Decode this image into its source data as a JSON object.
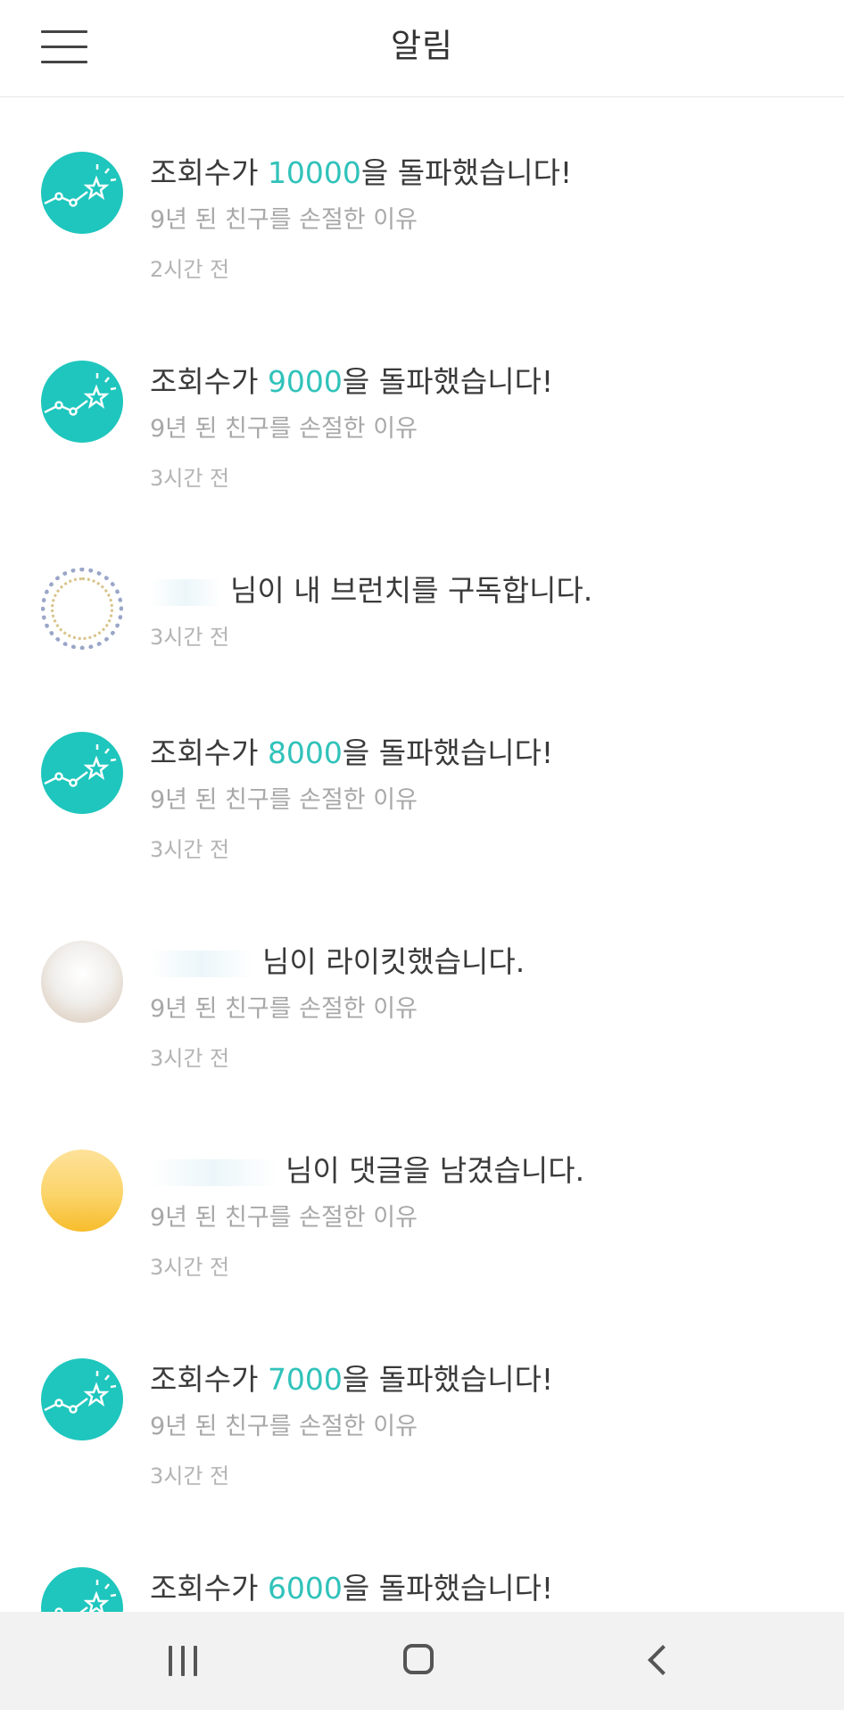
{
  "header": {
    "title": "알림"
  },
  "notifications": [
    {
      "type": "views",
      "prefix": "조회수가 ",
      "number": "10000",
      "suffix": "을 돌파했습니다!",
      "post": "9년 된 친구를 손절한 이유",
      "time": "2시간 전"
    },
    {
      "type": "views",
      "prefix": "조회수가 ",
      "number": "9000",
      "suffix": "을 돌파했습니다!",
      "post": "9년 된 친구를 손절한 이유",
      "time": "3시간 전"
    },
    {
      "type": "subscribe",
      "message": "님이 내 브런치를 구독합니다.",
      "time": "3시간 전"
    },
    {
      "type": "views",
      "prefix": "조회수가 ",
      "number": "8000",
      "suffix": "을 돌파했습니다!",
      "post": "9년 된 친구를 손절한 이유",
      "time": "3시간 전"
    },
    {
      "type": "like",
      "message": "님이 라이킷했습니다.",
      "post": "9년 된 친구를 손절한 이유",
      "time": "3시간 전"
    },
    {
      "type": "comment",
      "message": "님이 댓글을 남겼습니다.",
      "post": "9년 된 친구를 손절한 이유",
      "time": "3시간 전"
    },
    {
      "type": "views",
      "prefix": "조회수가 ",
      "number": "7000",
      "suffix": "을 돌파했습니다!",
      "post": "9년 된 친구를 손절한 이유",
      "time": "3시간 전"
    },
    {
      "type": "views",
      "prefix": "조회수가 ",
      "number": "6000",
      "suffix": "을 돌파했습니다!"
    }
  ],
  "colors": {
    "accent": "#30c2ba",
    "teal_avatar": "#1ec6bd"
  },
  "icons": {
    "views_avatar": "rising-chart-star-icon",
    "nav_recent": "recent-apps-icon",
    "nav_home": "home-icon",
    "nav_back": "back-icon",
    "menu": "hamburger-menu-icon"
  }
}
